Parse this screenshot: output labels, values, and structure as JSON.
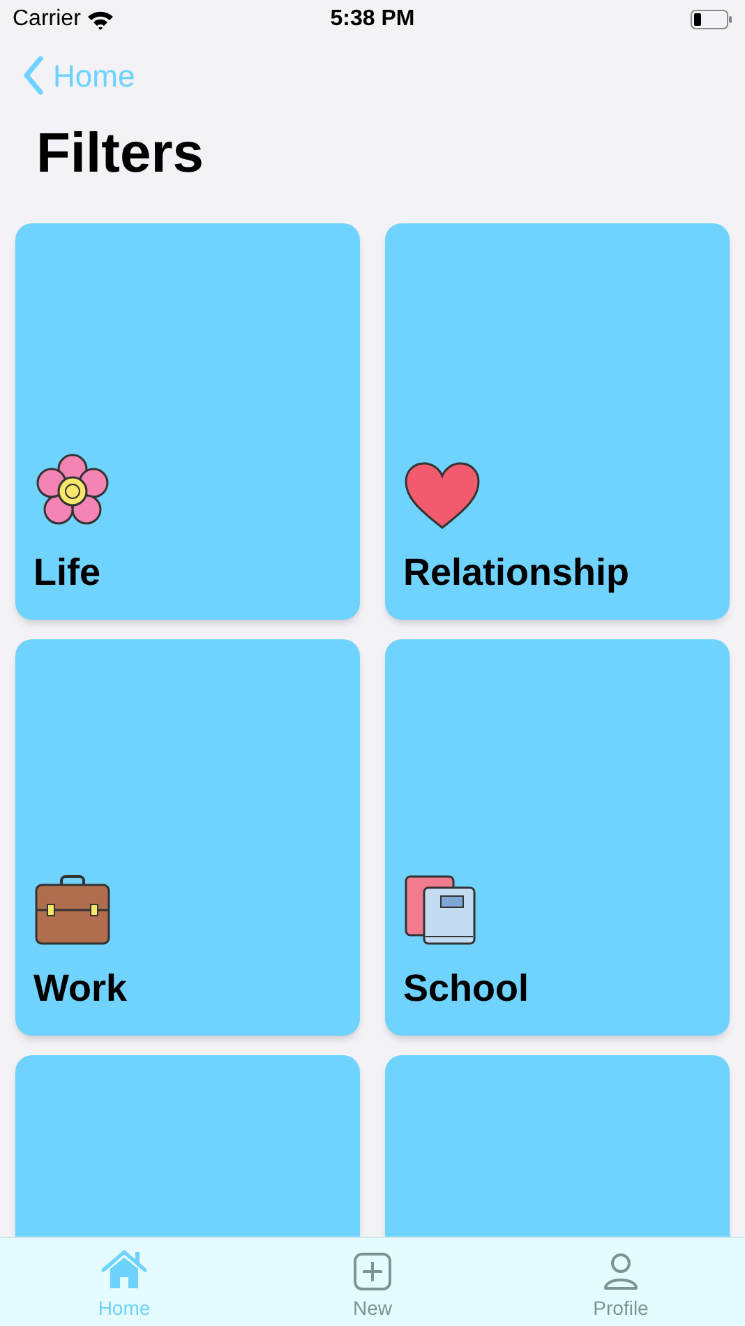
{
  "status_bar": {
    "carrier": "Carrier",
    "time": "5:38 PM"
  },
  "nav": {
    "back_label": "Home",
    "title": "Filters"
  },
  "cards": [
    {
      "kind": "category",
      "label": "Life"
    },
    {
      "kind": "category",
      "label": "Relationship"
    },
    {
      "kind": "category",
      "label": "Work"
    },
    {
      "kind": "category",
      "label": "School"
    },
    {
      "kind": "blank"
    },
    {
      "kind": "blank"
    }
  ],
  "tabs": [
    {
      "label": "Home",
      "selected": true
    },
    {
      "label": "New",
      "selected": false
    },
    {
      "label": "Profile",
      "selected": false
    }
  ]
}
